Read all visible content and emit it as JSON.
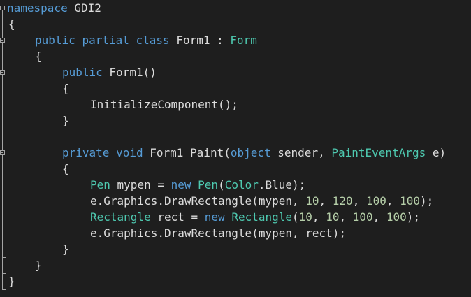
{
  "colors": {
    "background": "#1e1e1e",
    "keyword": "#569cd6",
    "type": "#4ec9b0",
    "plain": "#dcdcdc",
    "number": "#b5cea8",
    "gutter_guide": "#a5a5a5"
  },
  "code": {
    "l1": {
      "kw1": "namespace",
      "t1": " GDI2"
    },
    "l2": {
      "t1": "{"
    },
    "l3": {
      "kw1": "public",
      "s1": " ",
      "kw2": "partial",
      "s2": " ",
      "kw3": "class",
      "t1": " Form1 : ",
      "ty1": "Form"
    },
    "l4": {
      "t1": "{"
    },
    "l5": {
      "kw1": "public",
      "t1": " Form1()"
    },
    "l6": {
      "t1": "{"
    },
    "l7": {
      "t1": "InitializeComponent();"
    },
    "l8": {
      "t1": "}"
    },
    "l9": {
      "kw1": "private",
      "s1": " ",
      "kw2": "void",
      "t1": " Form1_Paint(",
      "kw3": "object",
      "t2": " sender, ",
      "ty1": "PaintEventArgs",
      "t3": " e)"
    },
    "l10": {
      "t1": "{"
    },
    "l11": {
      "ty1": "Pen",
      "t1": " mypen = ",
      "kw1": "new",
      "s1": " ",
      "ty2": "Pen",
      "t2": "(",
      "ty3": "Color",
      "t3": ".Blue);"
    },
    "l12": {
      "t1": "e.Graphics.DrawRectangle(mypen, ",
      "n1": "10",
      "t2": ", ",
      "n2": "120",
      "t3": ", ",
      "n3": "100",
      "t4": ", ",
      "n4": "100",
      "t5": ");"
    },
    "l13": {
      "ty1": "Rectangle",
      "t1": " rect = ",
      "kw1": "new",
      "s1": " ",
      "ty2": "Rectangle",
      "t2": "(",
      "n1": "10",
      "t3": ", ",
      "n2": "10",
      "t4": ", ",
      "n3": "100",
      "t5": ", ",
      "n4": "100",
      "t6": ");"
    },
    "l14": {
      "t1": "e.Graphics.DrawRectangle(mypen, rect);"
    },
    "l15": {
      "t1": "}"
    },
    "l16": {
      "t1": "}"
    },
    "l17": {
      "t1": "}"
    }
  }
}
